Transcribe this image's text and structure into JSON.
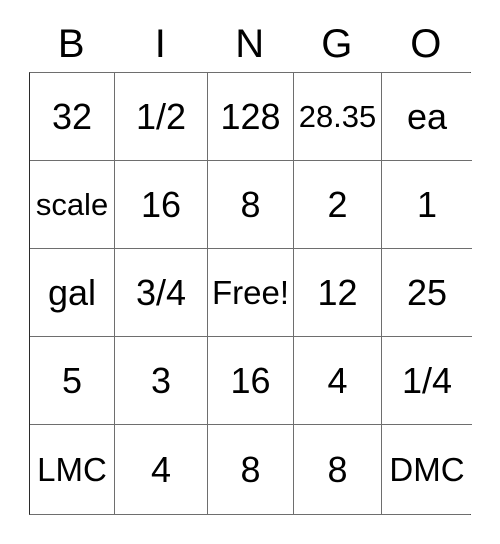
{
  "card": {
    "headers": [
      "B",
      "I",
      "N",
      "G",
      "O"
    ],
    "rows": [
      [
        "32",
        "1/2",
        "128",
        "28.35",
        "ea"
      ],
      [
        "scale",
        "16",
        "8",
        "2",
        "1"
      ],
      [
        "gal",
        "3/4",
        "Free!",
        "12",
        "25"
      ],
      [
        "5",
        "3",
        "16",
        "4",
        "1/4"
      ],
      [
        "LMC",
        "4",
        "8",
        "8",
        "DMC"
      ]
    ],
    "free_space_label": "Free!",
    "colors": {
      "text": "#000000",
      "background": "#ffffff",
      "grid_line": "#6e6e6e",
      "outer_border": "#2b2b2b"
    }
  }
}
